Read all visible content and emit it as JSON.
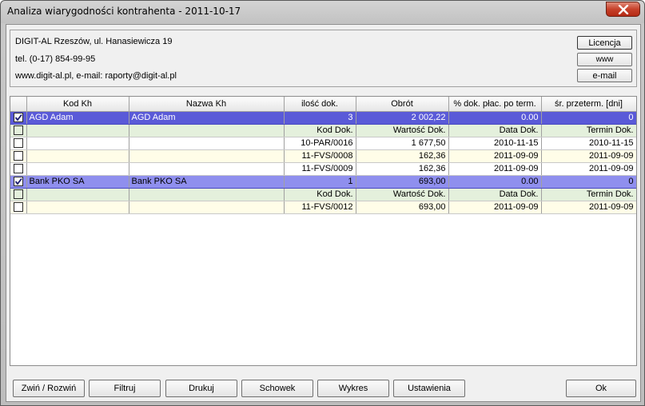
{
  "window": {
    "title": "Analiza wiarygodności kontrahenta - 2011-10-17"
  },
  "company": {
    "line1": "DIGIT-AL Rzeszów, ul. Hanasiewicza 19",
    "line2": "tel. (0-17) 854-99-95",
    "line3": "www.digit-al.pl,  e-mail: raporty@digit-al.pl"
  },
  "side_buttons": {
    "license": "Licencja",
    "www": "www",
    "email": "e-mail"
  },
  "table": {
    "headers": [
      "Kod Kh",
      "Nazwa Kh",
      "ilość dok.",
      "Obrót",
      "% dok. płac. po term.",
      "śr. przeterm. [dni]"
    ],
    "groups": [
      {
        "kod": "AGD Adam",
        "nazwa": "AGD Adam",
        "ilosc": "3",
        "obrot": "2 002,22",
        "pct": "0.00",
        "sr": "0",
        "sub_headers": [
          "Kod Dok.",
          "Wartość Dok.",
          "Data Dok.",
          "Termin Dok."
        ],
        "docs": [
          {
            "kod": "10-PAR/0016",
            "wartosc": "1 677,50",
            "data": "2010-11-15",
            "termin": "2010-11-15"
          },
          {
            "kod": "11-FVS/0008",
            "wartosc": "162,36",
            "data": "2011-09-09",
            "termin": "2011-09-09"
          },
          {
            "kod": "11-FVS/0009",
            "wartosc": "162,36",
            "data": "2011-09-09",
            "termin": "2011-09-09"
          }
        ]
      },
      {
        "kod": "Bank PKO SA",
        "nazwa": "Bank PKO SA",
        "ilosc": "1",
        "obrot": "693,00",
        "pct": "0.00",
        "sr": "0",
        "sub_headers": [
          "Kod Dok.",
          "Wartość Dok.",
          "Data Dok.",
          "Termin Dok."
        ],
        "docs": [
          {
            "kod": "11-FVS/0012",
            "wartosc": "693,00",
            "data": "2011-09-09",
            "termin": "2011-09-09"
          }
        ]
      }
    ]
  },
  "bottom_buttons": {
    "toggle": "Zwiń / Rozwiń",
    "filter": "Filtruj",
    "print": "Drukuj",
    "clipboard": "Schowek",
    "chart": "Wykres",
    "settings": "Ustawienia",
    "ok": "Ok"
  },
  "colors": {
    "selected_row": "#5a5ad8",
    "selected_row_light": "#8f8fee",
    "sub_header_row": "#e4f0dc",
    "doc_row_alt": "#fffde8"
  }
}
